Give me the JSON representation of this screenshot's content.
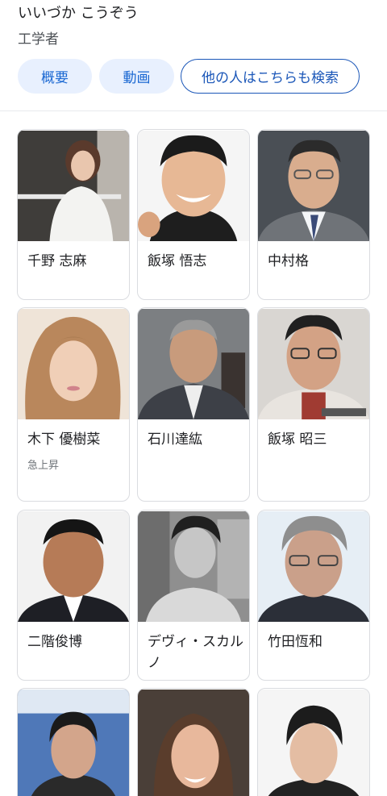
{
  "header": {
    "reading": "いいづか こうぞう",
    "profession": "工学者"
  },
  "chips": [
    {
      "label": "概要"
    },
    {
      "label": "動画"
    },
    {
      "label": "他の人はこちらも検索"
    }
  ],
  "people": [
    {
      "name": "千野 志麻"
    },
    {
      "name": "飯塚 悟志"
    },
    {
      "name": "中村格"
    },
    {
      "name": "木下 優樹菜",
      "badge": "急上昇"
    },
    {
      "name": "石川達紘"
    },
    {
      "name": "飯塚 昭三"
    },
    {
      "name": "二階俊博"
    },
    {
      "name": "デヴィ・スカルノ"
    },
    {
      "name": "竹田恆和"
    },
    {
      "name": ""
    },
    {
      "name": ""
    },
    {
      "name": ""
    }
  ]
}
